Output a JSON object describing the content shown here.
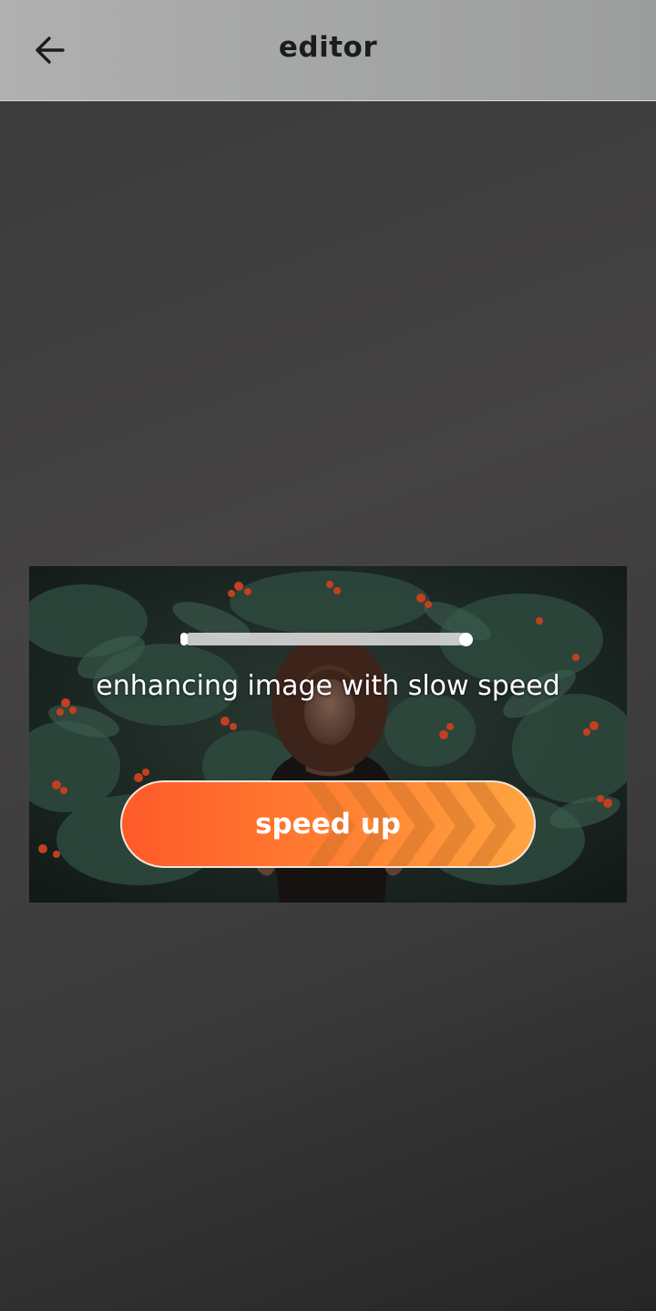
{
  "app_bar": {
    "title": "editor",
    "back_icon": "arrow-left-icon"
  },
  "enhance": {
    "progress_fraction": 0.97,
    "status_text": "enhancing image with slow speed",
    "speed_button_label": "speed up",
    "speed_button_colors": [
      "#ff5a2a",
      "#ffa540"
    ]
  }
}
